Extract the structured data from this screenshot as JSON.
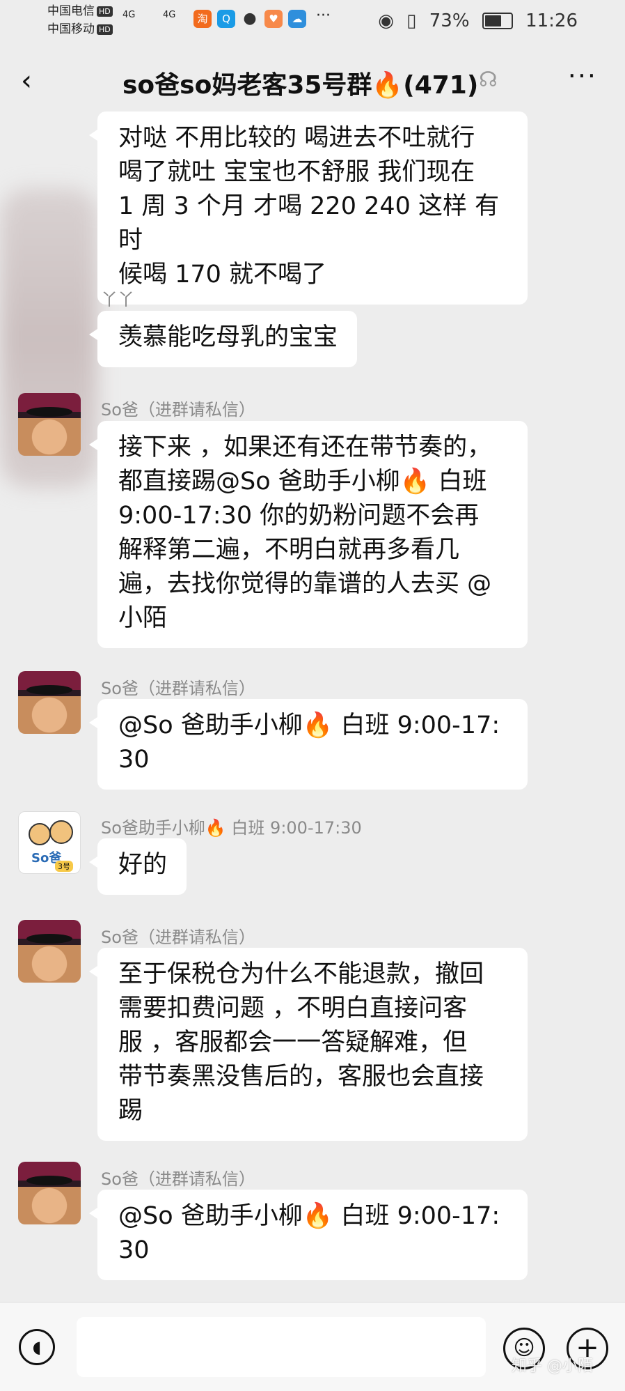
{
  "status_bar": {
    "carrier1": "中国电信",
    "carrier2": "中国移动",
    "hd": "HD",
    "signal1": "4G",
    "signal2": "4G",
    "app_icons": [
      "淘",
      "Q",
      "●",
      "♥",
      "☁"
    ],
    "more": "···",
    "battery": "73%",
    "battery_level": 0.73,
    "time": "11:26"
  },
  "header": {
    "title": "so爸so妈老客35号群🔥(471)",
    "back": "‹",
    "more": "···"
  },
  "messages": [
    {
      "sender": "",
      "text": "对哒 不用比较的 喝进去不吐就行\n喝了就吐 宝宝也不舒服 我们现在\n1 周 3 个月 才喝 220 240 这样 有时\n候喝 170 就不喝了"
    },
    {
      "sender": "丫丫",
      "text": "羡慕能吃母乳的宝宝"
    },
    {
      "sender": "So爸（进群请私信）",
      "text": "接下来 ，如果还有还在带节奏的，\n都直接踢@So 爸助手小柳🔥 白班\n9:00-17:30  你的奶粉问题不会再\n解释第二遍，不明白就再多看几\n遍，去找你觉得的靠谱的人去买 @\n小陌"
    },
    {
      "sender": "So爸（进群请私信）",
      "text": "@So 爸助手小柳🔥 白班 9:00-17:\n30"
    },
    {
      "sender": "So爸助手小柳🔥 白班 9:00-17:30",
      "text": "好的"
    },
    {
      "sender": "So爸（进群请私信）",
      "text": "至于保税仓为什么不能退款，撤回\n需要扣费问题 ，不明白直接问客\n服 ，客服都会一一答疑解难，但\n带节奏黑没售后的，客服也会直接\n踢"
    },
    {
      "sender": "So爸（进群请私信）",
      "text": "@So 爸助手小柳🔥 白班 9:00-17:\n30"
    }
  ],
  "assistant_avatar": {
    "tag": "So爸",
    "num": "3号"
  },
  "input_bar": {
    "placeholder": ""
  },
  "watermark": "知乎 @小陌"
}
